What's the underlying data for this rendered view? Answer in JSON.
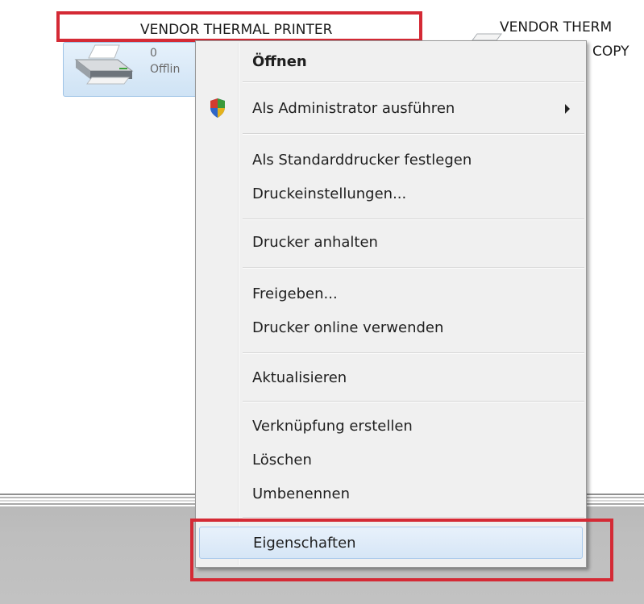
{
  "printers": [
    {
      "name": "VENDOR THERMAL PRINTER",
      "queue": "0",
      "status": "Offlin"
    },
    {
      "name": "VENDOR THERM",
      "name_line2": "COPY"
    }
  ],
  "context_menu": {
    "items": [
      {
        "label": "Öffnen",
        "bold": true
      },
      {
        "label": "Als Administrator ausführen",
        "submenu": true
      },
      {
        "label": "Als Standarddrucker festlegen"
      },
      {
        "label": "Druckeinstellungen..."
      },
      {
        "label": "Drucker anhalten"
      },
      {
        "label": "Freigeben..."
      },
      {
        "label": "Drucker online verwenden"
      },
      {
        "label": "Aktualisieren"
      },
      {
        "label": "Verknüpfung erstellen"
      },
      {
        "label": "Löschen"
      },
      {
        "label": "Umbenennen"
      },
      {
        "label": "Eigenschaften",
        "hovered": true
      }
    ]
  },
  "colors": {
    "highlight_annotation": "#d42a35",
    "menu_background": "#f0f0f0",
    "hover_background": "#dbe9f7"
  },
  "icons": [
    "printer-icon",
    "shield-icon",
    "submenu-arrow-icon"
  ]
}
